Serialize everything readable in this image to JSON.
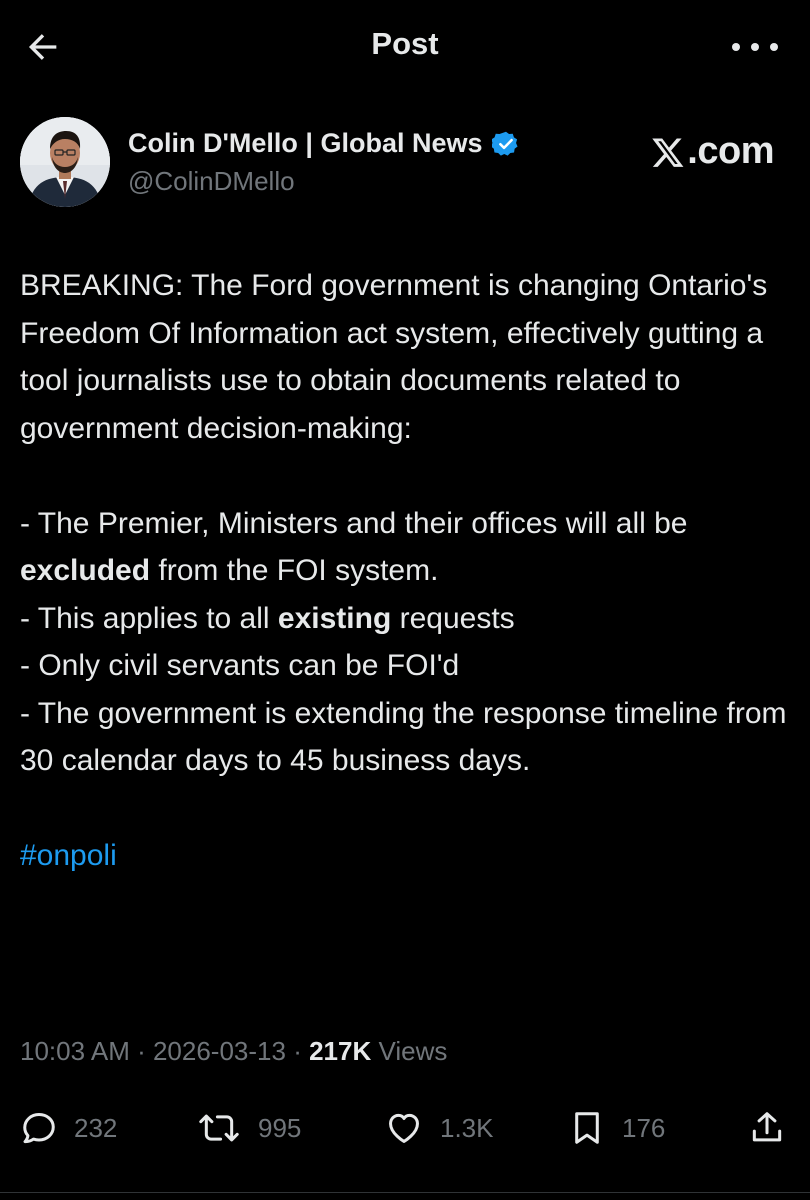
{
  "header": {
    "title": "Post"
  },
  "author": {
    "name": "Colin D'Mello | Global News",
    "handle": "@ColinDMello",
    "verified": true
  },
  "watermark": {
    "text": ".com"
  },
  "post": {
    "intro": "BREAKING: The Ford government is changing Ontario's Freedom Of Information act system, effectively gutting a tool journalists use to obtain documents related to government decision-making:",
    "bullet1_pre": "- The Premier, Ministers and their offices will all be ",
    "bullet1_bold": "excluded",
    "bullet1_post": " from the FOI system.",
    "bullet2_pre": "- This applies to all ",
    "bullet2_bold": "existing",
    "bullet2_post": " requests",
    "bullet3": "- Only civil servants can be FOI'd",
    "bullet4": "- The government is extending the response timeline from 30 calendar days to 45 business days.",
    "hashtag": "#onpoli"
  },
  "meta": {
    "time": "10:03 AM",
    "separator": " · ",
    "date": "2026-03-13",
    "views_count": "217K",
    "views_label": " Views"
  },
  "actions": {
    "replies": "232",
    "reposts": "995",
    "likes": "1.3K",
    "bookmarks": "176"
  },
  "colors": {
    "background": "#000000",
    "text": "#e7e9ea",
    "muted": "#71767b",
    "accent": "#1d9bf0"
  },
  "icons": [
    "back-arrow-icon",
    "more-dots-icon",
    "verified-badge-icon",
    "x-logo-icon",
    "reply-icon",
    "repost-icon",
    "like-icon",
    "bookmark-icon",
    "share-icon"
  ]
}
